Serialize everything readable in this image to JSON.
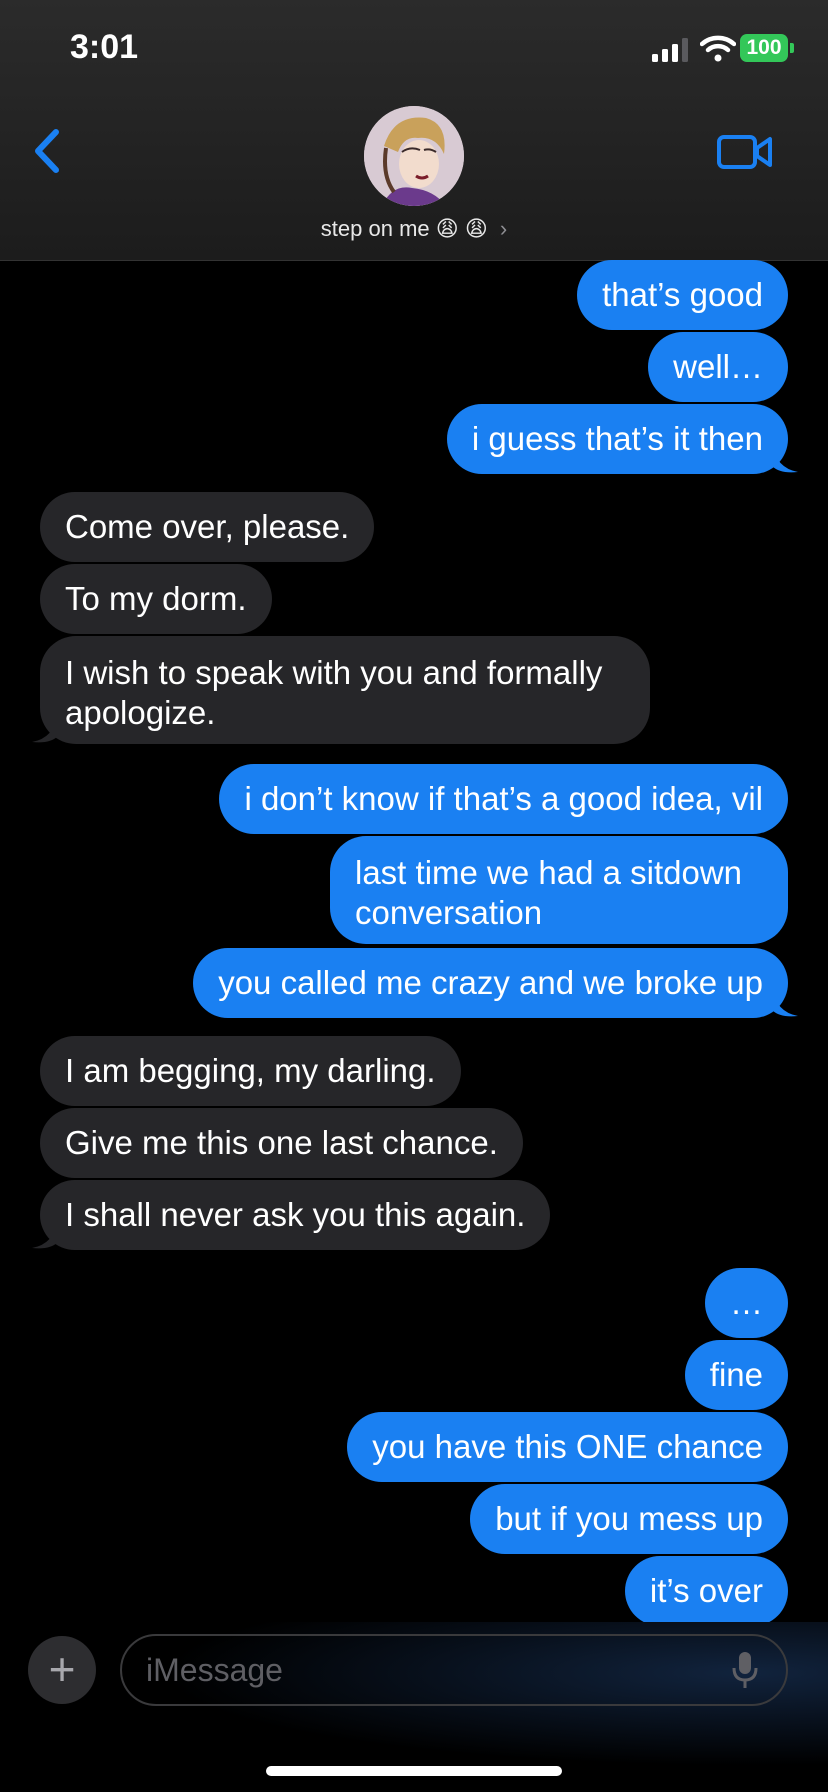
{
  "status": {
    "time": "3:01",
    "battery": "100"
  },
  "contact": {
    "name": "step on me",
    "emoji": "😩 😩"
  },
  "messages": [
    {
      "dir": "out",
      "text": "that’s good"
    },
    {
      "dir": "out",
      "text": "well…"
    },
    {
      "dir": "out",
      "text": "i guess that’s it then"
    },
    {
      "dir": "in",
      "text": "Come over, please."
    },
    {
      "dir": "in",
      "text": "To my dorm."
    },
    {
      "dir": "in",
      "text": "I wish to speak with you and formally apologize."
    },
    {
      "dir": "out",
      "text": "i don’t know if that’s a good idea, vil"
    },
    {
      "dir": "out",
      "text": "last time we had a sitdown conversation"
    },
    {
      "dir": "out",
      "text": "you called me crazy and we broke up"
    },
    {
      "dir": "in",
      "text": "I am begging, my darling."
    },
    {
      "dir": "in",
      "text": "Give me this one last chance."
    },
    {
      "dir": "in",
      "text": "I shall never ask you this again."
    },
    {
      "dir": "out",
      "text": "…"
    },
    {
      "dir": "out",
      "text": "fine"
    },
    {
      "dir": "out",
      "text": "you have this ONE chance"
    },
    {
      "dir": "out",
      "text": "but if you mess up"
    },
    {
      "dir": "out",
      "text": "it’s over"
    }
  ],
  "input": {
    "placeholder": "iMessage"
  },
  "colors": {
    "outgoing": "#1a80f2",
    "incoming": "#262629",
    "accent": "#1a80f2",
    "battery": "#33c759"
  },
  "icons": [
    "back-chevron-icon",
    "video-camera-icon",
    "plus-icon",
    "microphone-icon",
    "wifi-icon",
    "signal-icon"
  ]
}
